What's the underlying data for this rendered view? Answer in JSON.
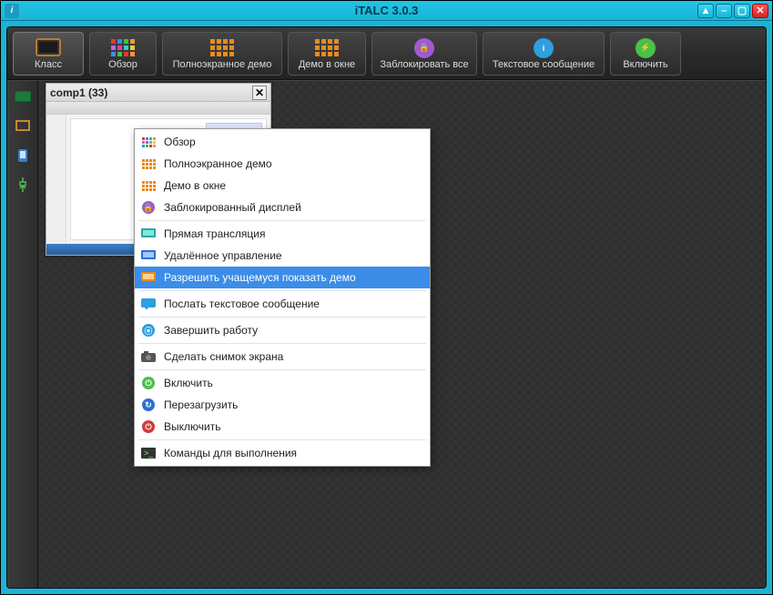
{
  "window": {
    "title": "iTALC 3.0.3",
    "app_icon_label": "i"
  },
  "toolbar": [
    {
      "label": "Класс"
    },
    {
      "label": "Обзор"
    },
    {
      "label": "Полноэкранное демо"
    },
    {
      "label": "Демо в окне"
    },
    {
      "label": "Заблокировать все"
    },
    {
      "label": "Текстовое сообщение"
    },
    {
      "label": "Включить"
    }
  ],
  "client": {
    "title": "comp1 (33)"
  },
  "context_menu": {
    "items": [
      {
        "label": "Обзор",
        "icon": "grid-multi"
      },
      {
        "label": "Полноэкранное демо",
        "icon": "grid-orange"
      },
      {
        "label": "Демо в окне",
        "icon": "grid-orange"
      },
      {
        "label": "Заблокированный дисплей",
        "icon": "lock-purple"
      },
      {
        "sep": true
      },
      {
        "label": "Прямая трансляция",
        "icon": "monitor-teal"
      },
      {
        "label": "Удалённое управление",
        "icon": "monitor-blue"
      },
      {
        "label": "Разрешить учащемуся показать демо",
        "icon": "monitor-orange",
        "highlighted": true
      },
      {
        "sep": true
      },
      {
        "label": "Послать текстовое сообщение",
        "icon": "msg-blue"
      },
      {
        "sep": true
      },
      {
        "label": "Завершить работу",
        "icon": "circle-blue"
      },
      {
        "sep": true
      },
      {
        "label": "Сделать снимок экрана",
        "icon": "camera"
      },
      {
        "sep": true
      },
      {
        "label": "Включить",
        "icon": "circle-green"
      },
      {
        "label": "Перезагрузить",
        "icon": "circle-blue2"
      },
      {
        "label": "Выключить",
        "icon": "circle-red"
      },
      {
        "sep": true
      },
      {
        "label": "Команды для выполнения",
        "icon": "terminal"
      }
    ]
  }
}
